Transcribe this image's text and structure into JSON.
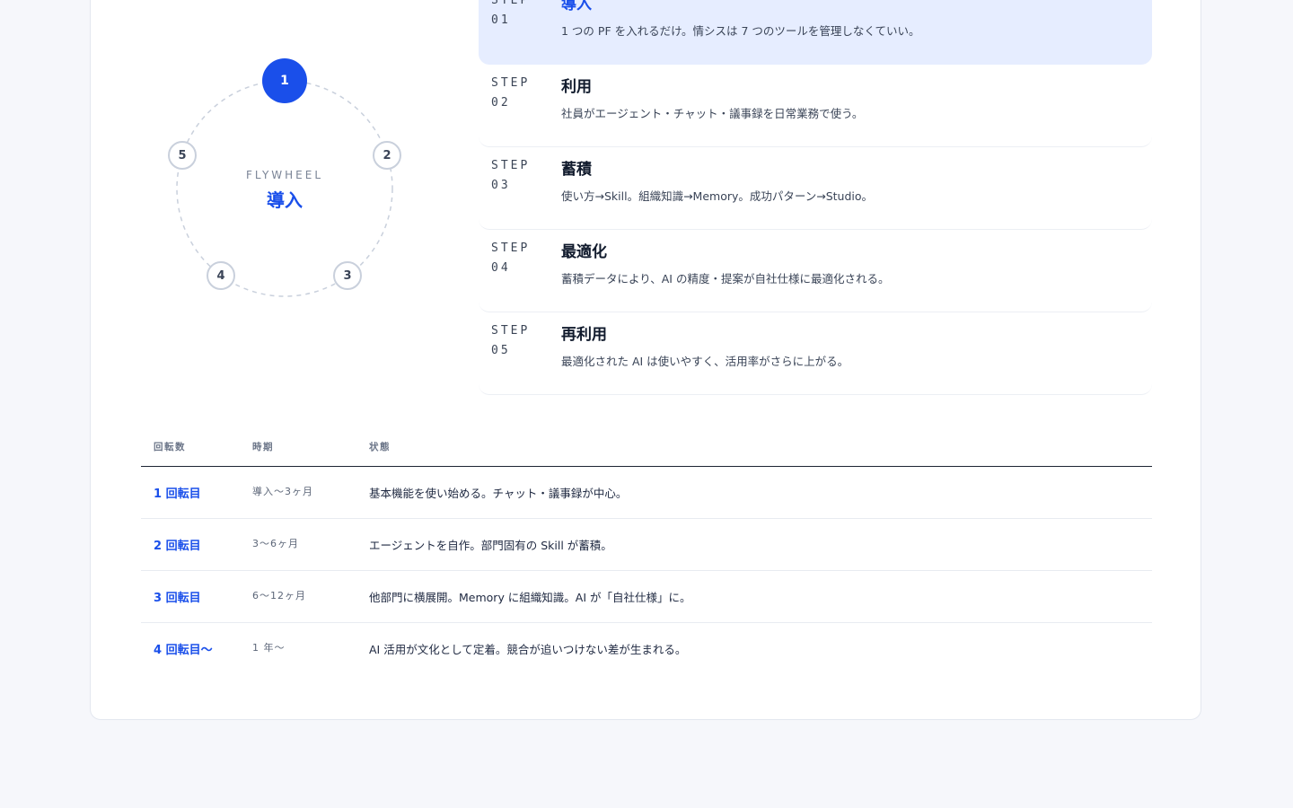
{
  "flywheel": {
    "caption": "FLYWHEEL",
    "current": "導入",
    "nodes": [
      "1",
      "2",
      "3",
      "4",
      "5"
    ],
    "active_node": "1",
    "accent": "#1a4fea"
  },
  "steps": [
    {
      "label": "STEP",
      "num": "01",
      "title": "導入",
      "desc": "1 つの PF を入れるだけ。情シスは 7 つのツールを管理しなくていい。",
      "active": true
    },
    {
      "label": "STEP",
      "num": "02",
      "title": "利用",
      "desc": "社員がエージェント・チャット・議事録を日常業務で使う。"
    },
    {
      "label": "STEP",
      "num": "03",
      "title": "蓄積",
      "desc": "使い方→Skill。組織知識→Memory。成功パターン→Studio。"
    },
    {
      "label": "STEP",
      "num": "04",
      "title": "最適化",
      "desc": "蓄積データにより、AI の精度・提案が自社仕様に最適化される。"
    },
    {
      "label": "STEP",
      "num": "05",
      "title": "再利用",
      "desc": "最適化された AI は使いやすく、活用率がさらに上がる。"
    }
  ],
  "table": {
    "headers": {
      "round": "回転数",
      "period": "時期",
      "state": "状態"
    },
    "rows": [
      {
        "round": "1 回転目",
        "period": "導入〜3ヶ月",
        "state": "基本機能を使い始める。チャット・議事録が中心。"
      },
      {
        "round": "2 回転目",
        "period": "3〜6ヶ月",
        "state": "エージェントを自作。部門固有の Skill が蓄積。"
      },
      {
        "round": "3 回転目",
        "period": "6〜12ヶ月",
        "state": "他部門に横展開。Memory に組織知識。AI が「自社仕様」に。"
      },
      {
        "round": "4 回転目〜",
        "period": "1 年〜",
        "state": "AI 活用が文化として定着。競合が追いつけない差が生まれる。"
      }
    ]
  }
}
